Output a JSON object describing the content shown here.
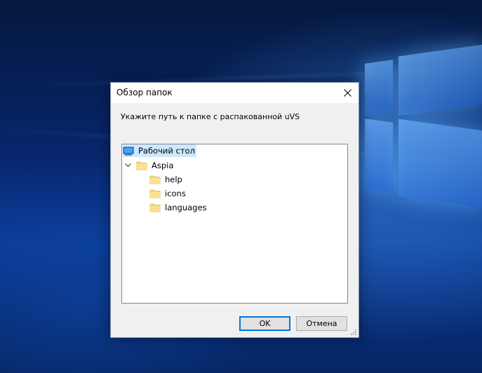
{
  "dialog": {
    "title": "Обзор папок",
    "instruction": "Укажите путь к папке с распакованной uVS",
    "ok_label": "OK",
    "cancel_label": "Отмена"
  },
  "tree": {
    "items": [
      {
        "label": "Рабочий стол",
        "icon": "desktop-icon",
        "selected": true
      },
      {
        "label": "Aspia",
        "icon": "folder-icon",
        "expanded": true
      },
      {
        "label": "help",
        "icon": "folder-icon"
      },
      {
        "label": "icons",
        "icon": "folder-icon"
      },
      {
        "label": "languages",
        "icon": "folder-icon"
      }
    ]
  },
  "colors": {
    "selection": "#cce8ff",
    "accent": "#0078d7",
    "folder": "#f8d775"
  }
}
